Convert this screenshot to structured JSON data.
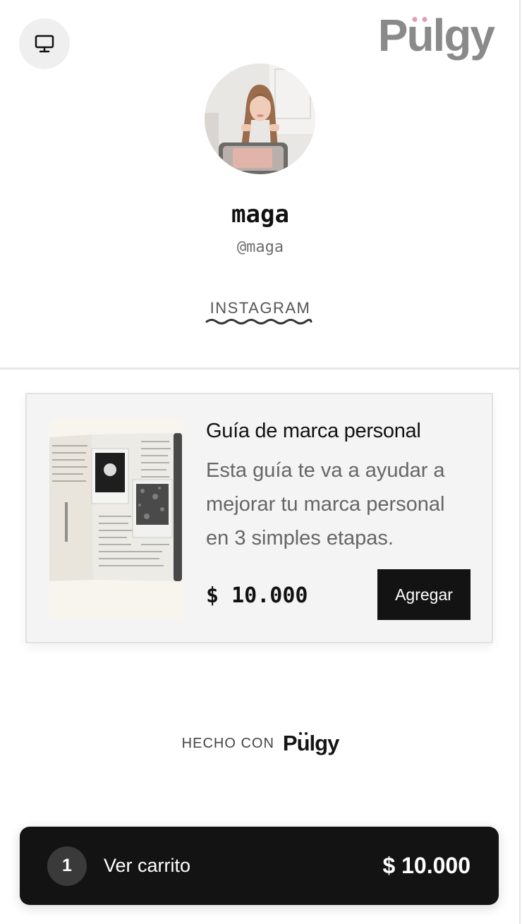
{
  "brand": {
    "logo_text_left": "P",
    "logo_text_u": "u",
    "logo_text_right": "lgy",
    "logo_accent": "#e79bb0",
    "logo_color": "#8a8a8a"
  },
  "header": {
    "desktop_icon": "monitor-icon"
  },
  "profile": {
    "name": "maga",
    "handle": "@maga",
    "social_link": "INSTAGRAM"
  },
  "product": {
    "title": "Guía de marca personal",
    "description": "Esta guía te va a ayudar a mejorar tu marca personal en 3 simples etapas.",
    "price": "$ 10.000",
    "add_label": "Agregar"
  },
  "footer": {
    "made_with": "HECHO CON",
    "logo_left": "P",
    "logo_u": "u",
    "logo_right": "lgy"
  },
  "cart": {
    "count": "1",
    "label": "Ver carrito",
    "total": "$ 10.000"
  }
}
